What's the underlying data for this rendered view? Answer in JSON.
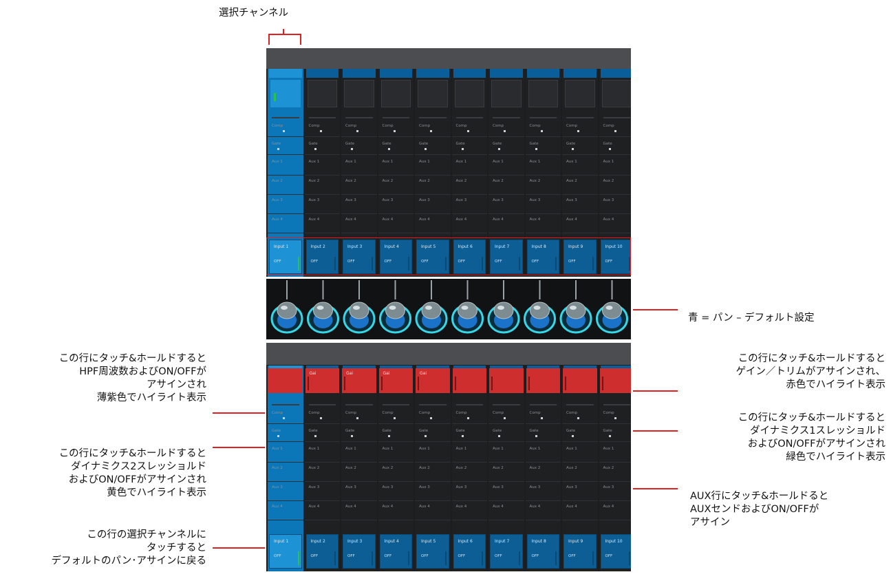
{
  "top_label": "選択チャンネル",
  "annotations": {
    "pan": "青 = パン – デフォルト設定",
    "hpf": [
      "この行にタッチ&ホールドすると",
      "HPF周波数およびON/OFFが",
      "アサインされ",
      "薄紫色でハイライト表示"
    ],
    "dyn2": [
      "この行にタッチ&ホールドすると",
      "ダイナミクス2スレッショルド",
      "およびON/OFFがアサインされ",
      "黄色でハイライト表示"
    ],
    "select": [
      "この行の選択チャンネルに",
      "タッチすると",
      "デフォルトのパン･アサインに戻る"
    ],
    "gain": [
      "この行にタッチ&ホールドすると",
      "ゲイン／トリムがアサインされ、",
      "赤色でハイライト表示"
    ],
    "dyn1": [
      "この行にタッチ&ホールドすると",
      "ダイナミクス1スレッショルド",
      "およびON/OFFがアサインされ",
      "緑色でハイライト表示"
    ],
    "aux": [
      "AUX行にタッチ&ホールドると",
      "AUXセンドおよびON/OFFが",
      "アサイン"
    ]
  },
  "channels": [
    "Input 1",
    "Input 2",
    "Input 3",
    "Input 4",
    "Input 5",
    "Input 6",
    "Input 7",
    "Input 8",
    "Input 9",
    "Input 10"
  ],
  "row_labels": {
    "comp": "Comp",
    "gate": "Gate",
    "aux": [
      "Aux 1",
      "Aux 2",
      "Aux 3",
      "Aux 4"
    ]
  },
  "off_label": "OFF",
  "gain_label": "Gai",
  "top_panel_header": "",
  "colors": {
    "accent_red": "#e02020",
    "strip_blue": "#0c5e95",
    "selected_blue": "#1d93d6",
    "gain_red": "#cf2e2e",
    "meter_green": "#26c44c"
  },
  "icons": {
    "fader_knob": "blue-ring-knob-icon"
  }
}
